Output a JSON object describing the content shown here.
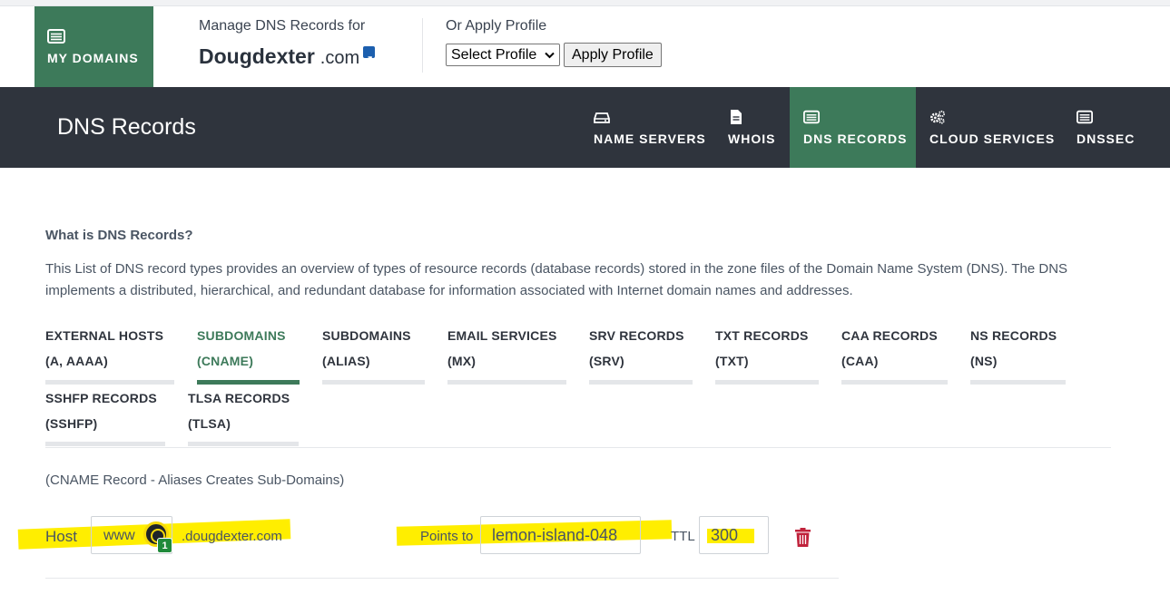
{
  "header": {
    "my_domains_label": "MY DOMAINS",
    "manage_label": "Manage DNS Records for",
    "domain_name": "Dougdexter",
    "domain_tld": ".com",
    "profile_label": "Or Apply Profile",
    "profile_select_value": "Select Profile",
    "apply_profile_button": "Apply Profile"
  },
  "navbar": {
    "title": "DNS Records",
    "items": [
      {
        "label": "NAME SERVERS",
        "icon": "hdd-icon"
      },
      {
        "label": "WHOIS",
        "icon": "document-icon"
      },
      {
        "label": "DNS RECORDS",
        "icon": "list-icon",
        "active": true
      },
      {
        "label": "CLOUD SERVICES",
        "icon": "gears-icon"
      },
      {
        "label": "DNSSEC",
        "icon": "list-icon"
      }
    ]
  },
  "content": {
    "what_is_heading": "What is DNS Records?",
    "description": "This List of DNS record types provides an overview of types of resource records (database records) stored in the zone files of the Domain Name System (DNS). The DNS implements a distributed, hierarchical, and redundant database for information associated with Internet domain names and addresses.",
    "tabs": [
      {
        "line1": "EXTERNAL HOSTS",
        "line2": "(A, AAAA)"
      },
      {
        "line1": "SUBDOMAINS",
        "line2": "(CNAME)",
        "active": true
      },
      {
        "line1": "SUBDOMAINS",
        "line2": "(ALIAS)"
      },
      {
        "line1": "EMAIL SERVICES",
        "line2": "(MX)"
      },
      {
        "line1": "SRV RECORDS",
        "line2": "(SRV)"
      },
      {
        "line1": "TXT RECORDS",
        "line2": "(TXT)"
      },
      {
        "line1": "CAA RECORDS",
        "line2": "(CAA)"
      },
      {
        "line1": "NS RECORDS",
        "line2": "(NS)"
      },
      {
        "line1": "SSHFP RECORDS",
        "line2": "(SSHFP)"
      },
      {
        "line1": "TLSA RECORDS",
        "line2": "(TLSA)"
      }
    ],
    "cname_note": "(CNAME Record - Aliases Creates Sub-Domains)",
    "record": {
      "host_label": "Host",
      "host_value": "www",
      "host_suffix": ".dougdexter.com",
      "points_to_label": "Points to",
      "points_to_value": "lemon-island-048",
      "ttl_label": "TTL",
      "ttl_value": "300",
      "password_badge_count": "1"
    }
  },
  "colors": {
    "accent_green": "#3d7a5a",
    "navbar_dark": "#2f343d",
    "highlight_yellow": "#ffee00",
    "delete_red": "#c0223b"
  }
}
